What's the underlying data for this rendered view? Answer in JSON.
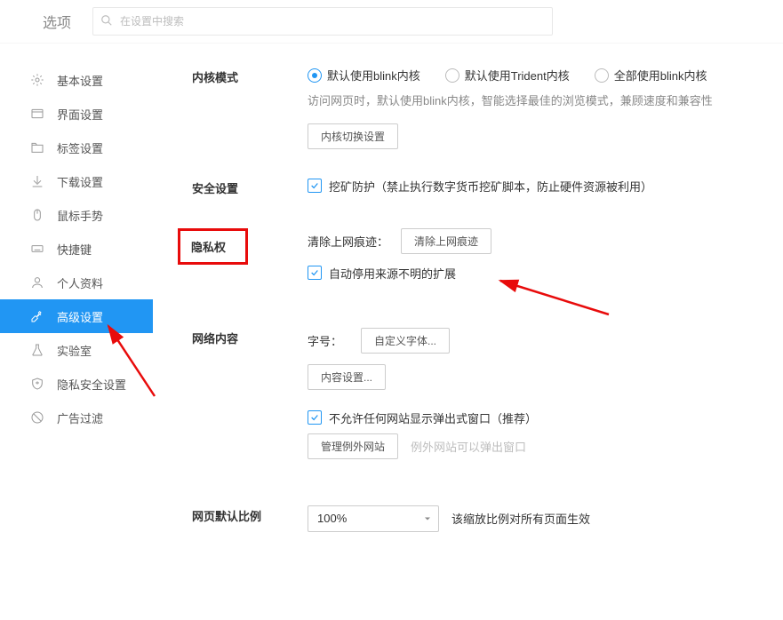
{
  "header": {
    "title": "选项",
    "search_placeholder": "在设置中搜索"
  },
  "sidebar": {
    "items": [
      {
        "label": "基本设置",
        "icon": "gear"
      },
      {
        "label": "界面设置",
        "icon": "window"
      },
      {
        "label": "标签设置",
        "icon": "tabs"
      },
      {
        "label": "下载设置",
        "icon": "download"
      },
      {
        "label": "鼠标手势",
        "icon": "mouse"
      },
      {
        "label": "快捷键",
        "icon": "keyboard"
      },
      {
        "label": "个人资料",
        "icon": "user"
      },
      {
        "label": "高级设置",
        "icon": "wrench",
        "active": true
      },
      {
        "label": "实验室",
        "icon": "flask"
      },
      {
        "label": "隐私安全设置",
        "icon": "shield"
      },
      {
        "label": "广告过滤",
        "icon": "block"
      }
    ]
  },
  "kernel": {
    "title": "内核模式",
    "options": [
      "默认使用blink内核",
      "默认使用Trident内核",
      "全部使用blink内核"
    ],
    "selected": 0,
    "desc": "访问网页时，默认使用blink内核，智能选择最佳的浏览模式，兼顾速度和兼容性",
    "button": "内核切换设置"
  },
  "security": {
    "title": "安全设置",
    "option": "挖矿防护（禁止执行数字货币挖矿脚本，防止硬件资源被利用）"
  },
  "privacy": {
    "title": "隐私权",
    "clear_label": "清除上网痕迹：",
    "clear_button": "清除上网痕迹",
    "disable_ext": "自动停用来源不明的扩展"
  },
  "webcontent": {
    "title": "网络内容",
    "font_label": "字号：",
    "font_button": "自定义字体...",
    "content_button": "内容设置...",
    "popup_block": "不允许任何网站显示弹出式窗口（推荐）",
    "manage_button": "管理例外网站",
    "manage_hint": "例外网站可以弹出窗口"
  },
  "zoom": {
    "title": "网页默认比例",
    "value": "100%",
    "desc": "该缩放比例对所有页面生效"
  }
}
